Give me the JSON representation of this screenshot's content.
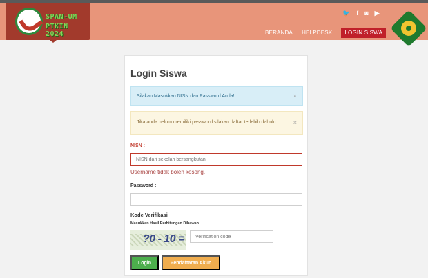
{
  "header": {
    "logo_line1": "SPAN-UM",
    "logo_line2": "PTKIN 2024",
    "social_icons": [
      "twitter-icon",
      "facebook-icon",
      "instagram-icon",
      "youtube-icon"
    ],
    "social_glyphs": [
      "🐦",
      "f",
      "◙",
      "▶"
    ],
    "nav": [
      {
        "label": "BERANDA"
      },
      {
        "label": "HELPDESK"
      },
      {
        "label": "LOGIN SISWA"
      }
    ],
    "colors": {
      "header_bg": "#e8957a",
      "logo_bg": "#a23a2c",
      "active_nav": "#c0202a"
    }
  },
  "card": {
    "title": "Login Siswa",
    "alerts": [
      {
        "text": "Silakan Masukkan NISN dan Password Anda!",
        "close": "×"
      },
      {
        "text": "Jika anda belum memiliki password silakan daftar terlebih dahulu !",
        "close": "×"
      }
    ],
    "nisn": {
      "label": "NISN :",
      "placeholder": "NISN dari sekolah bersangkutan",
      "error": "Username tidak boleh kosong."
    },
    "password": {
      "label": "Password :",
      "value": ""
    },
    "verification": {
      "label": "Kode Verifikasi",
      "sublabel": "Masukkan Hasil Perhitungan Dibawah",
      "captcha_text": "?0 - 10 =",
      "placeholder": "Verification code"
    },
    "buttons": {
      "login": "Login",
      "register": "Pendaftaran Akun"
    },
    "colors": {
      "login": "#4cae4c",
      "register": "#f0ad4e",
      "error": "#a94442"
    }
  }
}
